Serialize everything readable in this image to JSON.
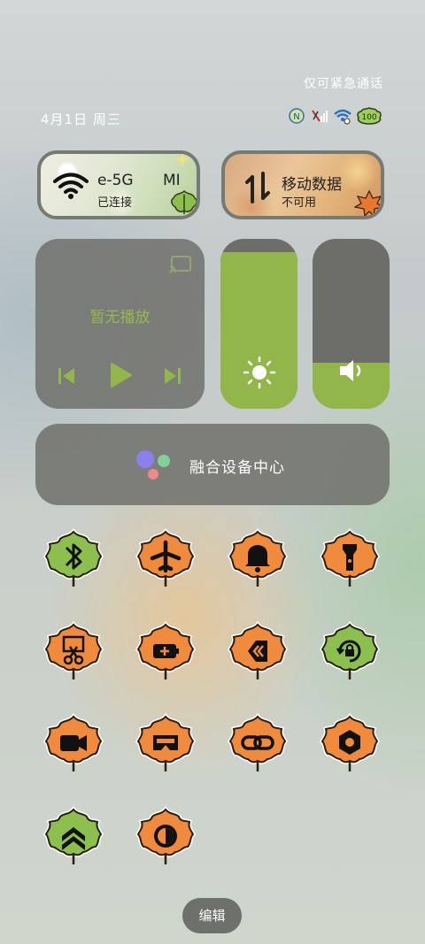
{
  "status": {
    "emergency_text": "仅可紧急通话",
    "date_text": "4月1日 周三",
    "battery": "100"
  },
  "wifi_tile": {
    "title": "e-5G",
    "title_suffix": "MI",
    "subtitle": "已连接"
  },
  "data_tile": {
    "title": "移动数据",
    "subtitle": "不可用"
  },
  "media": {
    "label": "暂无播放"
  },
  "brightness": {
    "level_fraction": 0.92
  },
  "volume": {
    "level_fraction": 0.27
  },
  "fusion": {
    "label": "融合设备中心"
  },
  "toggles": [
    {
      "name": "bluetooth-toggle",
      "icon": "bluetooth-icon",
      "leaf": "green"
    },
    {
      "name": "airplane-mode-toggle",
      "icon": "airplane-icon",
      "leaf": "orange"
    },
    {
      "name": "ring-mode-toggle",
      "icon": "bell-icon",
      "leaf": "orange"
    },
    {
      "name": "flashlight-toggle",
      "icon": "flashlight-icon",
      "leaf": "orange"
    },
    {
      "name": "screenshot-toggle",
      "icon": "scissors-icon",
      "leaf": "orange"
    },
    {
      "name": "battery-saver-toggle",
      "icon": "battery-plus-icon",
      "leaf": "orange"
    },
    {
      "name": "share-toggle",
      "icon": "share-icon",
      "leaf": "orange"
    },
    {
      "name": "rotation-lock-toggle",
      "icon": "rotation-lock-icon",
      "leaf": "green"
    },
    {
      "name": "screen-record-toggle",
      "icon": "video-camera-icon",
      "leaf": "orange"
    },
    {
      "name": "vr-toggle",
      "icon": "vr-headset-icon",
      "leaf": "orange"
    },
    {
      "name": "link-toggle",
      "icon": "link-icon",
      "leaf": "orange"
    },
    {
      "name": "settings-toggle",
      "icon": "hexagon-gear-icon",
      "leaf": "orange"
    },
    {
      "name": "performance-toggle",
      "icon": "double-chevron-up-icon",
      "leaf": "green"
    },
    {
      "name": "dark-mode-toggle",
      "icon": "contrast-icon",
      "leaf": "orange"
    }
  ],
  "edit_label": "编辑",
  "colors": {
    "accent_green": "#93b64b",
    "leaf_orange": "#f08a3c",
    "leaf_green": "#8cc04e"
  }
}
